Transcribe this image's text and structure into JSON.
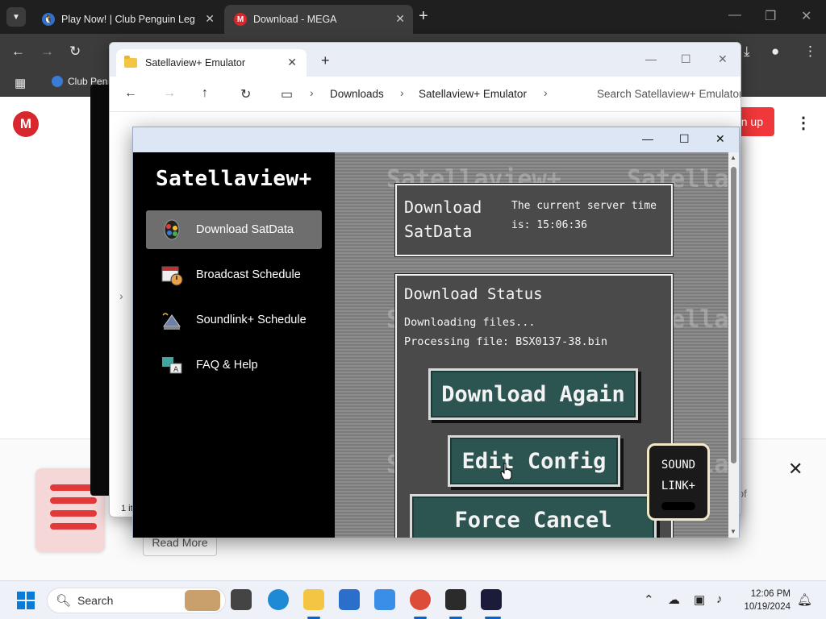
{
  "chrome": {
    "tabs": [
      {
        "title": "Play Now! | Club Penguin Legac",
        "active": false
      },
      {
        "title": "Download - MEGA",
        "active": true
      }
    ],
    "bookmark_label": "Club Pen",
    "window_controls": {
      "minimize": "—",
      "maximize": "❐",
      "close": "✕"
    }
  },
  "mega": {
    "logo": "M",
    "signup_label": "n up",
    "banner_partial_text": "e of",
    "read_more_label": "Read More"
  },
  "explorer": {
    "tab_title": "Satellaview+ Emulator",
    "breadcrumb": [
      "Downloads",
      "Satellaview+ Emulator"
    ],
    "search_placeholder": "Search Satellaview+ Emulator",
    "status_text": "1 it"
  },
  "app": {
    "title": "Satellaview+",
    "nav_items": [
      {
        "label": "Download SatData",
        "icon": "satellite-dish-icon",
        "active": true
      },
      {
        "label": "Broadcast Schedule",
        "icon": "calendar-clock-icon",
        "active": false
      },
      {
        "label": "Soundlink+ Schedule",
        "icon": "radio-antenna-icon",
        "active": false
      },
      {
        "label": "FAQ & Help",
        "icon": "help-translate-icon",
        "active": false
      }
    ],
    "download_panel": {
      "title_line1": "Download",
      "title_line2": "SatData",
      "server_time_line1": "The current server time",
      "server_time_line2": "is: 15:06:36"
    },
    "status_panel": {
      "title": "Download Status",
      "line1": "Downloading files...",
      "line2": "Processing file: BSX0137-38.bin"
    },
    "buttons": {
      "download_again": "Download Again",
      "edit_config": "Edit Config",
      "force_cancel": "Force Cancel"
    },
    "soundlink": {
      "line1": "SOUND",
      "line2": "LINK+"
    },
    "watermark": "Satellaview+"
  },
  "taskbar": {
    "search_label": "Search",
    "time": "12:06 PM",
    "date": "10/19/2024"
  },
  "colors": {
    "mega_red": "#d9272e",
    "button_teal": "#2c5551",
    "panel_gray": "#4a4a4a",
    "chrome_dark": "#1f1f1f"
  }
}
